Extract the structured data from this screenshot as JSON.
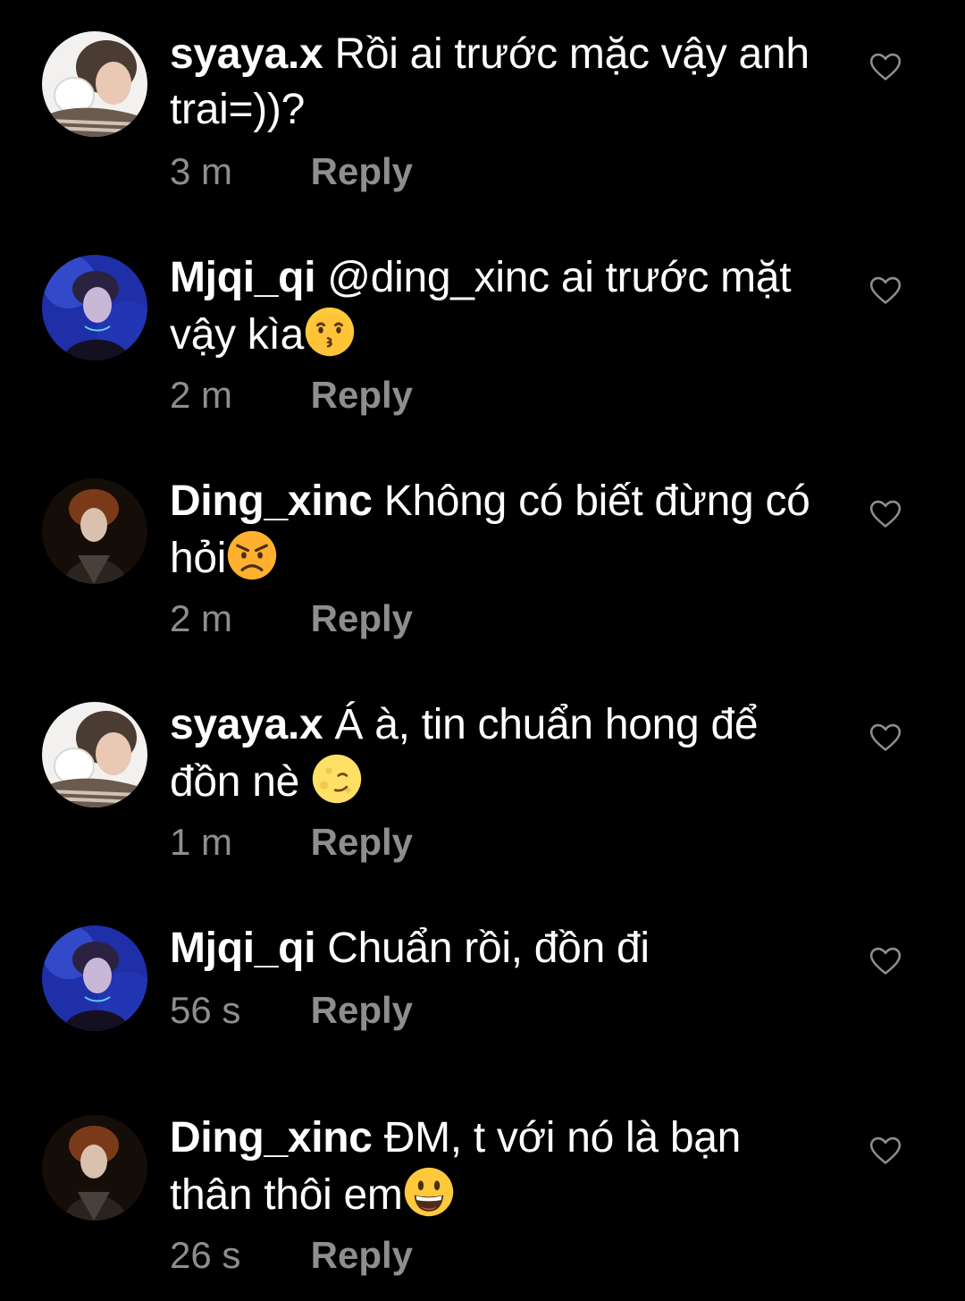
{
  "comments": [
    {
      "username": "syaya.x",
      "text": "Rồi ai trước mặc vậy anh trai=))?",
      "emoji": "",
      "time": "3 m",
      "reply_label": "Reply",
      "avatar": "avatar-girl-icon"
    },
    {
      "username": "Mjqi_qi",
      "text": "@ding_xinc ai trước mặt vậy kìa",
      "emoji": "kissing-face-icon",
      "time": "2 m",
      "reply_label": "Reply",
      "avatar": "avatar-blue-icon"
    },
    {
      "username": "Ding_xinc",
      "text": "Không có biết đừng có hỏi",
      "emoji": "angry-face-icon",
      "time": "2 m",
      "reply_label": "Reply",
      "avatar": "avatar-dark-icon"
    },
    {
      "username": "syaya.x",
      "text": "Á à, tin chuẩn hong để đồn nè ",
      "emoji": "moon-face-icon",
      "time": "1 m",
      "reply_label": "Reply",
      "avatar": "avatar-girl-icon"
    },
    {
      "username": "Mjqi_qi",
      "text": "Chuẩn rồi, đồn đi",
      "emoji": "",
      "time": "56 s",
      "reply_label": "Reply",
      "avatar": "avatar-blue-icon"
    },
    {
      "username": "Ding_xinc",
      "text": "ĐM, t với nó là bạn thân thôi em",
      "emoji": "grinning-face-icon",
      "time": "26 s",
      "reply_label": "Reply",
      "avatar": "avatar-dark-icon"
    }
  ],
  "icons": {
    "like": "heart-outline-icon"
  },
  "colors": {
    "background": "#000000",
    "text": "#ffffff",
    "meta": "#8e8e8e"
  }
}
